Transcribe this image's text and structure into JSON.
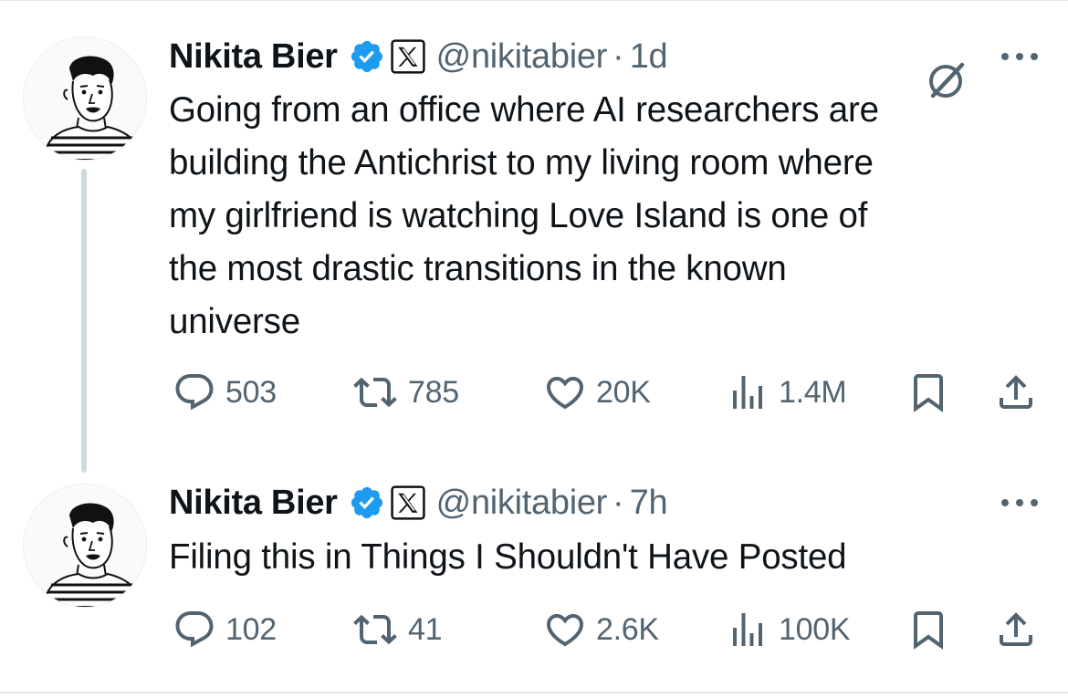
{
  "tweets": [
    {
      "author": "Nikita Bier",
      "handle": "@nikitabier",
      "separator": "·",
      "time": "1d",
      "text_lines": [
        "Going from an office where AI researchers are",
        "building the Antichrist to my living room where",
        "my girlfriend is watching Love Island is one of",
        "the most drastic transitions in the known",
        "universe"
      ],
      "stats": {
        "replies": "503",
        "reposts": "785",
        "likes": "20K",
        "views": "1.4M"
      }
    },
    {
      "author": "Nikita Bier",
      "handle": "@nikitabier",
      "separator": "·",
      "time": "7h",
      "text_lines": [
        "Filing this in Things I Shouldn't Have Posted"
      ],
      "stats": {
        "replies": "102",
        "reposts": "41",
        "likes": "2.6K",
        "views": "100K"
      }
    }
  ],
  "icons": {
    "verified": "verified-badge-icon",
    "affiliate": "x-logo-icon",
    "grok": "grok-icon",
    "more": "more-dots-icon",
    "reply": "reply-icon",
    "repost": "repost-icon",
    "like": "heart-icon",
    "views": "views-icon",
    "bookmark": "bookmark-icon",
    "share": "share-icon"
  },
  "colors": {
    "text": "#0f1419",
    "secondary": "#536471",
    "verified": "#1d9bf0",
    "thread_line": "#cfd9de"
  }
}
